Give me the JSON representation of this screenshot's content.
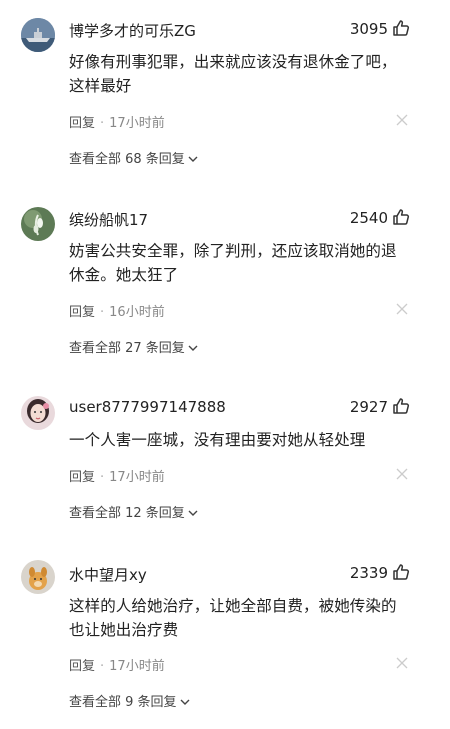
{
  "comments": [
    {
      "username": "博学多才的可乐ZG",
      "likes": "3095",
      "lines": [
        "好像有刑事犯罪，出来就应该没有退休金了吧，",
        "这样最好"
      ],
      "reply_label": "回复",
      "time": "17小时前",
      "view_replies": "查看全部 68 条回复",
      "avatar": "ship-avatar"
    },
    {
      "username": "缤纷船帆17",
      "likes": "2540",
      "lines": [
        "妨害公共安全罪，除了判刑，还应该取消她的退",
        "休金。她太狂了"
      ],
      "reply_label": "回复",
      "time": "16小时前",
      "view_replies": "查看全部 27 条回复",
      "avatar": "flower-avatar"
    },
    {
      "username": "user8777997147888",
      "likes": "2927",
      "lines": [
        "一个人害一座城，没有理由要对她从轻处理"
      ],
      "reply_label": "回复",
      "time": "17小时前",
      "view_replies": "查看全部 12 条回复",
      "avatar": "woman-avatar"
    },
    {
      "username": "水中望月xy",
      "likes": "2339",
      "lines": [
        "这样的人给她治疗，让她全部自费，被她传染的",
        "也让她出治疗费"
      ],
      "reply_label": "回复",
      "time": "17小时前",
      "view_replies": "查看全部 9 条回复",
      "avatar": "dog-avatar"
    }
  ]
}
